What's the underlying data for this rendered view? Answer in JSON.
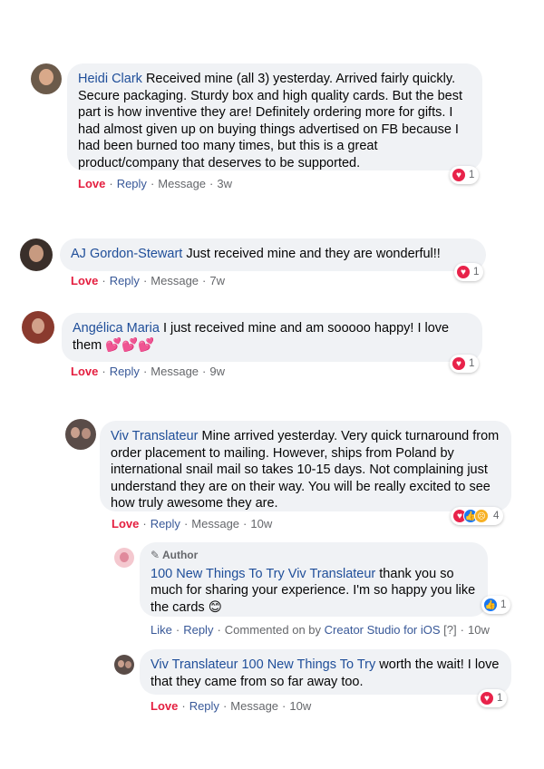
{
  "comments": [
    {
      "name": "Heidi Clark",
      "text": "Received mine (all 3) yesterday. Arrived fairly quickly. Secure packaging. Sturdy box and high quality cards. But the best part is how inventive they are! Definitely ordering more for gifts. I had almost given up on buying things advertised on FB because I had been burned too many times, but this is a great product/company that deserves to be supported.",
      "actions": {
        "love": "Love",
        "reply": "Reply",
        "message": "Message",
        "time": "3w"
      },
      "reaction_count": "1"
    },
    {
      "name": "AJ Gordon-Stewart",
      "text": "Just received mine and they are wonderful!!",
      "actions": {
        "love": "Love",
        "reply": "Reply",
        "message": "Message",
        "time": "7w"
      },
      "reaction_count": "1"
    },
    {
      "name": "Angélica Maria",
      "text": "I just received mine and am sooooo happy! I love them",
      "emoji": "💕💕💕",
      "actions": {
        "love": "Love",
        "reply": "Reply",
        "message": "Message",
        "time": "9w"
      },
      "reaction_count": "1"
    },
    {
      "name": "Viv Translateur",
      "text": "Mine arrived yesterday. Very quick turnaround from order placement to mailing. However, ships from Poland by international snail mail so takes 10-15 days. Not complaining just understand they are on their way. You will be really excited to see how truly awesome they are.",
      "actions": {
        "love": "Love",
        "reply": "Reply",
        "message": "Message",
        "time": "10w"
      },
      "reaction_count": "4"
    },
    {
      "author_badge": "Author",
      "name": "100 New Things To Try",
      "tag": "Viv Translateur",
      "text": "thank you so much for sharing your experience. I'm so happy you like the cards",
      "emoji": "😊",
      "actions": {
        "like": "Like",
        "reply": "Reply",
        "commented": "Commented on by",
        "tool": "Creator Studio for iOS",
        "help": "[?]",
        "time": "10w"
      },
      "reaction_count": "1"
    },
    {
      "name": "Viv Translateur",
      "tag": "100 New Things To Try",
      "text": "worth the wait! I love that they came from so far away too.",
      "actions": {
        "love": "Love",
        "reply": "Reply",
        "message": "Message",
        "time": "10w"
      },
      "reaction_count": "1"
    }
  ],
  "colors": {
    "name": "#1f4e99",
    "love": "#e41e3f",
    "bubble": "#f0f2f5",
    "heart": "#e8234a",
    "like": "#1877f2"
  }
}
